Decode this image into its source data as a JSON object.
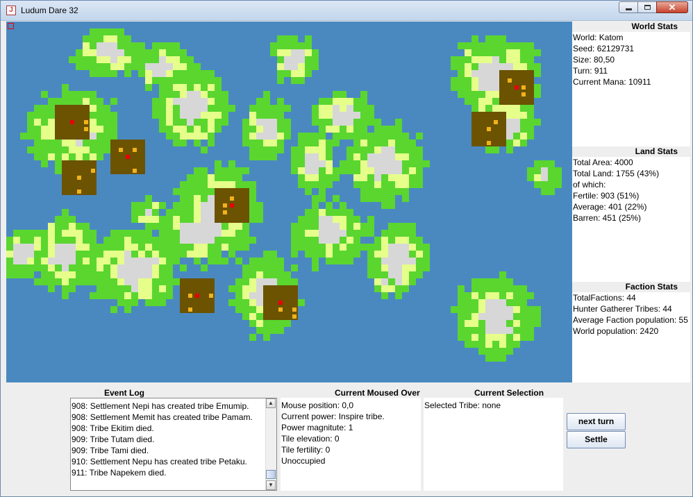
{
  "window": {
    "title": "Ludum Dare 32"
  },
  "colors": {
    "water": "#4a89c0",
    "fertile": "#5ad62f",
    "average": "#e6ff8a",
    "barren": "#d7d7d7",
    "settlement": "#6b5302",
    "tribe": "#f2b21b",
    "tribe_core": "#e8000c"
  },
  "world_stats": {
    "header": "World Stats",
    "lines": [
      "World: Katom",
      "Seed: 62129731",
      "Size: 80,50",
      "Turn: 911",
      "Current Mana: 10911"
    ]
  },
  "land_stats": {
    "header": "Land Stats",
    "lines": [
      "Total Area: 4000",
      "Total Land: 1755 (43%)",
      "of which:",
      "Fertile: 903 (51%)",
      "Average: 401 (22%)",
      "Barren: 451 (25%)"
    ]
  },
  "faction_stats": {
    "header": "Faction Stats",
    "lines": [
      "TotalFactions: 44",
      "Hunter Gatherer Tribes: 44",
      "Average Faction population: 55",
      "World population: 2420"
    ]
  },
  "event_log": {
    "label": "Event Log",
    "entries": [
      "908: Settlement Nepi has created tribe Emumip.",
      "908: Settlement Memit has created tribe Pamam.",
      "908: Tribe Ekitim died.",
      "909: Tribe Tutam died.",
      "909: Tribe Tami died.",
      "910: Settlement Nepu has created tribe Petaku.",
      "911: Tribe Napekem died."
    ]
  },
  "moused_over": {
    "label": "Current Moused Over",
    "lines": [
      "Mouse position: 0,0",
      "Current power: Inspire tribe.",
      "Power magnitute: 1",
      "Tile elevation: 0",
      "Tile fertility: 0",
      "Unoccupied"
    ]
  },
  "selection": {
    "label": "Current Selection",
    "lines": [
      "Selected Tribe: none"
    ]
  },
  "buttons": {
    "next_turn": "next turn",
    "settle": "Settle"
  },
  "icons": {
    "scroll_up": "scroll-up-icon",
    "scroll_down": "scroll-down-icon"
  }
}
